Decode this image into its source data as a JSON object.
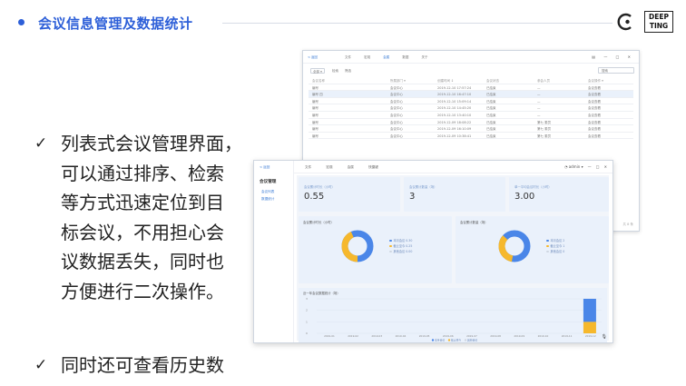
{
  "header": {
    "title": "会议信息管理及数据统计",
    "logo_text": [
      "DEEP",
      "TING"
    ]
  },
  "bullets": [
    {
      "lines": [
        "列表式会议管理界面，",
        "可以通过排序、检索",
        "等方式迅速定位到目",
        "标会议，不用担心会",
        "议数据丢失，同时也",
        "方便进行二次操作。"
      ]
    },
    {
      "lines": [
        "同时还可查看历史数"
      ]
    }
  ],
  "list_window": {
    "back": "< 返回",
    "tabs": [
      "文件",
      "宏观",
      "会属",
      "数据",
      "关于"
    ],
    "active_tab": 2,
    "filter": "全部 ▾",
    "filter2": "检索",
    "filter3": "筛选",
    "search_placeholder": "搜索",
    "columns": [
      "会议名称",
      "所属部门 ▾",
      "创建时间 ↕",
      "会议状态",
      "参会人员",
      "会议操作 ▾"
    ],
    "rows": [
      [
        "编号",
        "会议中心",
        "2019-12-10 17:57:24",
        "已结束",
        "—",
        "会议查看"
      ],
      [
        "编号 四",
        "会议中心",
        "2019-12-10 16:47:10",
        "已结束",
        "—",
        "会议查看"
      ],
      [
        "编号",
        "会议中心",
        "2019-12-10 15:09:14",
        "已结束",
        "—",
        "会议查看"
      ],
      [
        "编号",
        "会议中心",
        "2019-12-10 14:45:20",
        "已结束",
        "—",
        "会议查看"
      ],
      [
        "编号",
        "会议中心",
        "2019-12-10 13:40:10",
        "已结束",
        "—",
        "会议查看"
      ],
      [
        "编号",
        "会议中心",
        "2019-12-09 18:08:22",
        "已结束",
        "第七 委员",
        "会议查看"
      ],
      [
        "编号",
        "会议中心",
        "2019-12-09 16:10:09",
        "已结束",
        "第七 委员",
        "会议查看"
      ],
      [
        "编号",
        "会议中心",
        "2019-12-09 10:38:41",
        "已结束",
        "第七 委员",
        "会议查看"
      ]
    ],
    "footer": "共 8 条"
  },
  "dashboard": {
    "back": "< 返回",
    "sidebar_title": "会议管理",
    "sidebar_items": [
      "会议列表",
      "数据统计"
    ],
    "tabs": [
      "文件",
      "宏观",
      "会属",
      "快捷键"
    ],
    "user": "admin",
    "window_controls": [
      "—",
      "□",
      "✕"
    ],
    "cards": [
      {
        "label": "会议累计时长（小时）",
        "value": "0.55"
      },
      {
        "label": "会议累计数量（场）",
        "value": "3"
      },
      {
        "label": "单一平均会议时长（小时）",
        "value": "3.00"
      }
    ],
    "pies": [
      {
        "title": "会议累计时长（小时）",
        "legend": [
          "本月会议 0.30",
          "截止至今 0.25",
          "其他会议 0.00"
        ]
      },
      {
        "title": "会议累计数量（场）",
        "legend": [
          "本月会议 2",
          "截止至今 1",
          "其他会议 0"
        ]
      }
    ],
    "trend": {
      "title": "近一年会议数据统计（场）",
      "legend": [
        "本月会议",
        "截止至今",
        "其他会议"
      ]
    },
    "colors": {
      "blue": "#4a86e8",
      "orange": "#f6b82c",
      "gray": "#d0d7e2"
    }
  },
  "chart_data": {
    "type": "bar",
    "categories": [
      "2019-01",
      "2019-02",
      "2019-03",
      "2019-04",
      "2019-05",
      "2019-06",
      "2019-07",
      "2019-08",
      "2019-09",
      "2019-10",
      "2019-11",
      "2019-12"
    ],
    "series": [
      {
        "name": "本月会议",
        "values": [
          0,
          0,
          0,
          0,
          0,
          0,
          0,
          0,
          0,
          0,
          0,
          2
        ]
      },
      {
        "name": "截止至今",
        "values": [
          0,
          0,
          0,
          0,
          0,
          0,
          0,
          0,
          0,
          0,
          0,
          1
        ]
      }
    ],
    "ylim": [
      0,
      3
    ],
    "yticks": [
      "3",
      "2",
      "1",
      "0"
    ],
    "stacked": true
  }
}
